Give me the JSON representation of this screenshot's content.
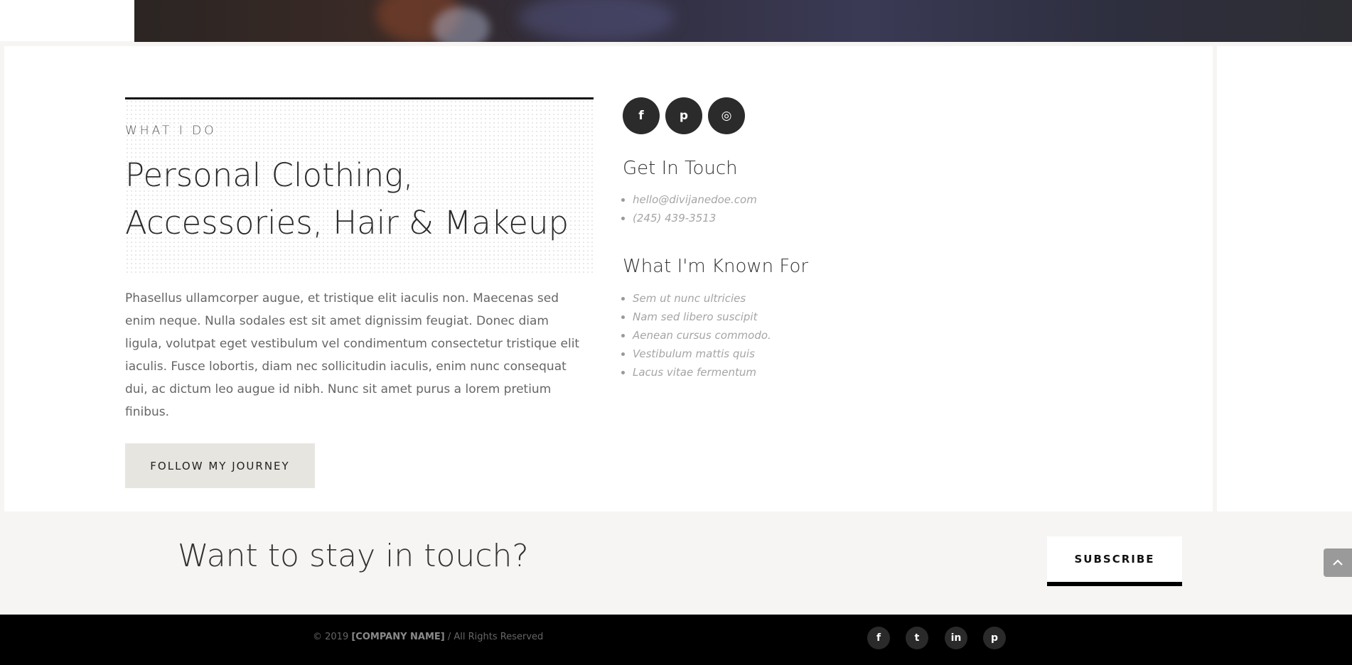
{
  "about": {
    "eyebrow": "WHAT I DO",
    "title": "Personal Clothing, Accessories, Hair & Makeup",
    "body": "Phasellus ullamcorper augue, et tristique elit iaculis non. Maecenas sed enim neque. Nulla sodales est sit amet dignissim feugiat. Donec diam ligula, volutpat eget vestibulum vel condimentum consectetur tristique elit iaculis. Fusce lobortis, diam nec sollicitudin iaculis, enim nunc consequat dui, ac dictum leo augue id nibh. Nunc sit amet purus a lorem pretium finibus.",
    "button_label": "FOLLOW MY JOURNEY"
  },
  "social": {
    "icons": [
      {
        "name": "facebook-icon",
        "glyph": "f"
      },
      {
        "name": "pinterest-icon",
        "glyph": "p"
      },
      {
        "name": "instagram-icon",
        "glyph": "◎"
      }
    ]
  },
  "contact": {
    "heading": "Get In Touch",
    "items": [
      "hello@divijanedoe.com",
      "(245) 439-3513"
    ]
  },
  "known_for": {
    "heading": "What I'm Known For",
    "items": [
      "Sem ut nunc ultricies",
      "Nam sed libero suscipit",
      "Aenean cursus commodo.",
      "Vestibulum mattis quis",
      "Lacus vitae fermentum"
    ]
  },
  "newsletter": {
    "title": "Want to stay in touch?",
    "button_label": "SUBSCRIBE"
  },
  "footer": {
    "copyright_prefix": "© 2019",
    "company": "[COMPANY NAME]",
    "copyright_suffix": "/  All Rights Reserved",
    "icons": [
      {
        "name": "facebook-icon",
        "glyph": "f"
      },
      {
        "name": "twitter-icon",
        "glyph": "t"
      },
      {
        "name": "linkedin-icon",
        "glyph": "in"
      },
      {
        "name": "pinterest-icon",
        "glyph": "p"
      }
    ]
  },
  "colors": {
    "page_bg": "#f6f5f3",
    "card_bg": "#ffffff",
    "dark": "#2b2b2b",
    "footer_bg": "#000000",
    "button_bg": "#e7e5e0"
  }
}
